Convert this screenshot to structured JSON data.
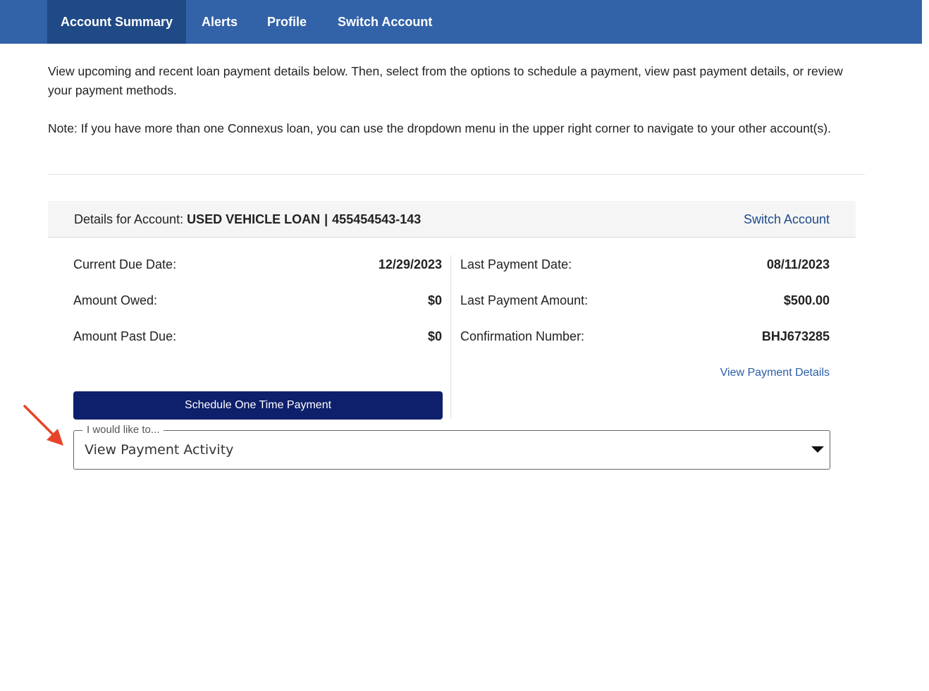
{
  "nav": {
    "tabs": [
      {
        "label": "Account Summary",
        "active": true
      },
      {
        "label": "Alerts",
        "active": false
      },
      {
        "label": "Profile",
        "active": false
      },
      {
        "label": "Switch Account",
        "active": false
      }
    ]
  },
  "intro": {
    "paragraph1": "View upcoming and recent loan payment details below. Then, select from the options to schedule a payment, view past payment details, or review your payment methods.",
    "paragraph2": "Note: If you have more than one Connexus loan, you can use the dropdown menu in the upper right corner to navigate to your other account(s)."
  },
  "account": {
    "details_prefix": "Details for Account:",
    "account_name": "USED VEHICLE LOAN",
    "separator": "|",
    "account_number": "455454543-143",
    "switch_label": "Switch Account"
  },
  "left_details": [
    {
      "label": "Current Due Date:",
      "value": "12/29/2023"
    },
    {
      "label": "Amount Owed:",
      "value": "$0"
    },
    {
      "label": "Amount Past Due:",
      "value": "$0"
    }
  ],
  "right_details": [
    {
      "label": "Last Payment Date:",
      "value": "08/11/2023"
    },
    {
      "label": "Last Payment Amount:",
      "value": "$500.00"
    },
    {
      "label": "Confirmation Number:",
      "value": "BHJ673285"
    }
  ],
  "links": {
    "view_payment_details": "View Payment Details"
  },
  "actions": {
    "schedule_button": "Schedule One Time Payment",
    "select_legend": "I would like to...",
    "select_value": "View Payment Activity"
  },
  "colors": {
    "nav_bg": "#3262a8",
    "nav_active": "#1f4a86",
    "button_bg": "#0e1f6b",
    "link": "#2b5ea7",
    "annotation_arrow": "#e8432a"
  },
  "icons": {
    "select_caret": "caret-down-icon",
    "annotation": "red-arrow-icon"
  }
}
